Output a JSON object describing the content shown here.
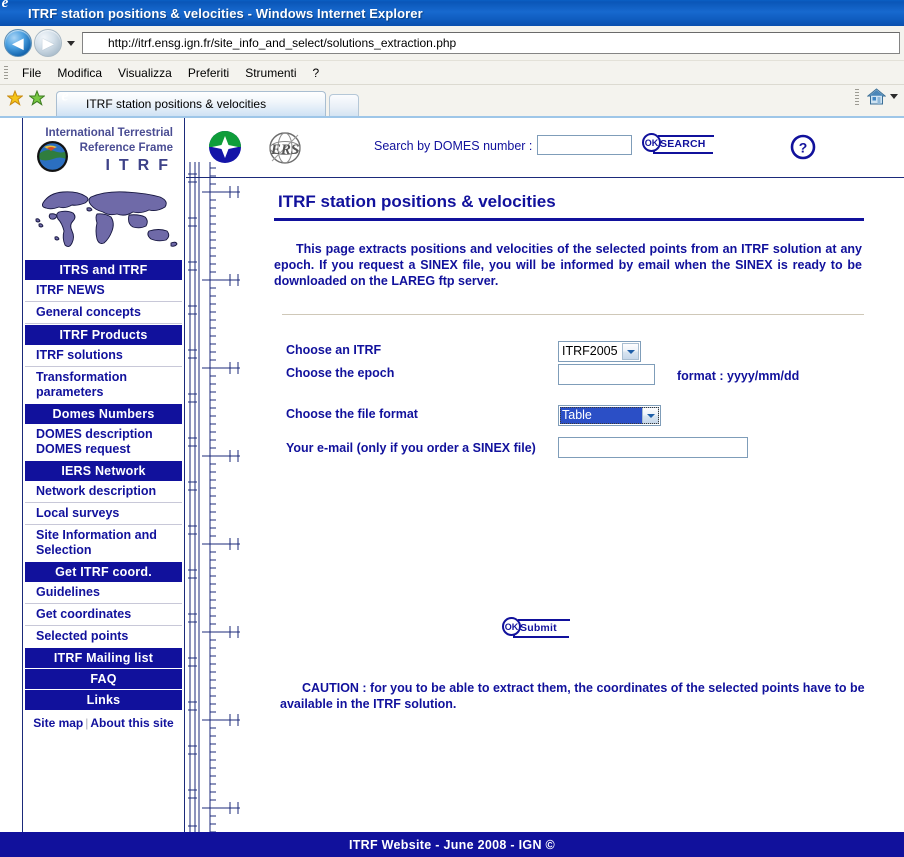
{
  "window": {
    "title": "ITRF station positions & velocities - Windows Internet Explorer",
    "icon": "ie-logo-icon"
  },
  "browser": {
    "url": "http://itrf.ensg.ign.fr/site_info_and_select/solutions_extraction.php",
    "back_icon": "back-arrow-icon",
    "forward_icon": "forward-arrow-icon",
    "history_caret_icon": "chevron-down-icon",
    "menu": [
      "File",
      "Modifica",
      "Visualizza",
      "Preferiti",
      "Strumenti",
      "?"
    ],
    "tab_label": "ITRF station positions & velocities",
    "favorites_icon": "star-icon",
    "add_favorite_icon": "add-star-icon",
    "home_icon": "home-icon",
    "tools_caret_icon": "chevron-down-icon"
  },
  "sidebar": {
    "logo_line1": "International Terrestrial",
    "logo_line2": "Reference Frame",
    "logo_acronym": "ITRF",
    "globe_icon": "globe-icon",
    "worldmap_icon": "world-map-icon",
    "items": [
      {
        "label": "ITRS and ITRF",
        "type": "header"
      },
      {
        "label": "ITRF NEWS",
        "type": "link"
      },
      {
        "label": "General concepts",
        "type": "link"
      },
      {
        "label": "ITRF Products",
        "type": "header"
      },
      {
        "label": "ITRF solutions",
        "type": "link"
      },
      {
        "label": "Transformation",
        "type": "link-a"
      },
      {
        "label": "parameters",
        "type": "link-b"
      },
      {
        "label": "Domes Numbers",
        "type": "header"
      },
      {
        "label": "DOMES description",
        "type": "link-a"
      },
      {
        "label": "DOMES request",
        "type": "link-b"
      },
      {
        "label": "IERS Network",
        "type": "header"
      },
      {
        "label": "Network description",
        "type": "link"
      },
      {
        "label": "Local surveys",
        "type": "link"
      },
      {
        "label": "Site Information and",
        "type": "link-a"
      },
      {
        "label": "Selection",
        "type": "link-b"
      },
      {
        "label": "Get ITRF coord.",
        "type": "header"
      },
      {
        "label": "Guidelines",
        "type": "link"
      },
      {
        "label": "Get coordinates",
        "type": "link"
      },
      {
        "label": "Selected points",
        "type": "link"
      },
      {
        "label": "ITRF Mailing list",
        "type": "header"
      },
      {
        "label": "FAQ",
        "type": "header"
      },
      {
        "label": "Links",
        "type": "header"
      }
    ],
    "site_map": "Site map",
    "separator": "|",
    "about": "About this site"
  },
  "banner": {
    "igs_logo_icon": "igs-logo-icon",
    "iers_logo_icon": "iers-logo-icon",
    "search_label": "Search by DOMES number :",
    "search_value": "",
    "search_placeholder": "",
    "search_button_badge": "OK",
    "search_button_label": "SEARCH",
    "help_icon": "question-mark-icon"
  },
  "main": {
    "page_title": "ITRF station positions & velocities",
    "intro": "This page extracts positions and velocities of the selected points from an ITRF solution at any epoch. If you request a SINEX file, you will be informed by email when the SINEX is ready to be downloaded on the LAREG ftp server.",
    "caution": "CAUTION : for you to be able to extract them, the coordinates of the selected points have to be available in the ITRF solution."
  },
  "form": {
    "itrf": {
      "label": "Choose an ITRF",
      "selected": "ITRF2005",
      "caret_icon": "chevron-down-icon"
    },
    "epoch": {
      "label": "Choose the epoch",
      "value": "",
      "hint": "format : yyyy/mm/dd"
    },
    "file_format": {
      "label": "Choose the file format",
      "selected": "Table",
      "caret_icon": "chevron-down-icon"
    },
    "email": {
      "label": "Your e-mail (only if you order a SINEX file)",
      "value": ""
    },
    "submit": {
      "badge": "OK",
      "label": "Submit"
    }
  },
  "footer": {
    "text": "ITRF Website - June 2008 - IGN ©"
  },
  "colors": {
    "brand_blue": "#11119c",
    "titlebar_blue": "#0f5cbf",
    "select_highlight": "#2b4fc6",
    "logo_purple": "#4a4d93",
    "rule_tan": "#cfc8b8"
  }
}
